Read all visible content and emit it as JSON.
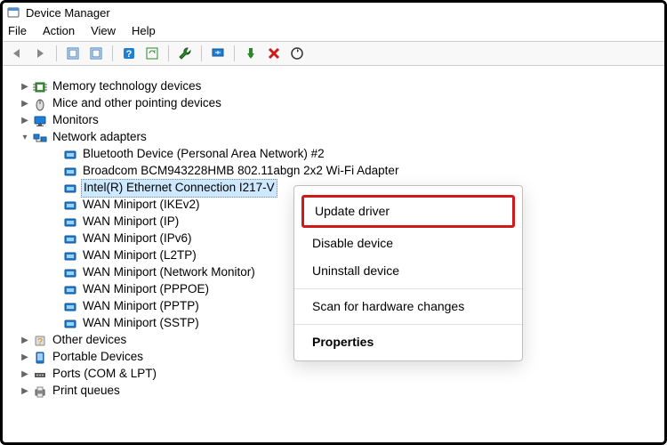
{
  "titlebar": {
    "title": "Device Manager"
  },
  "menubar": {
    "file": "File",
    "action": "Action",
    "view": "View",
    "help": "Help"
  },
  "toolbar_icons": {
    "back": "back-arrow-icon",
    "forward": "forward-arrow-icon",
    "show_hidden": "show-hidden-icon",
    "properties": "properties-icon",
    "help": "help-icon",
    "scan": "scan-hardware-icon",
    "add": "add-legacy-icon",
    "monitor": "remote-icon",
    "enable": "enable-device-icon",
    "remove": "remove-device-icon",
    "refresh": "refresh-icon"
  },
  "tree": {
    "memory": "Memory technology devices",
    "mice": "Mice and other pointing devices",
    "monitors": "Monitors",
    "netcat": "Network adapters",
    "net": {
      "bt": "Bluetooth Device (Personal Area Network) #2",
      "broadcom": "Broadcom BCM943228HMB 802.11abgn 2x2 Wi-Fi Adapter",
      "intel": "Intel(R) Ethernet Connection I217-V",
      "ikev2": "WAN Miniport (IKEv2)",
      "ip": "WAN Miniport (IP)",
      "ipv6": "WAN Miniport (IPv6)",
      "l2tp": "WAN Miniport (L2TP)",
      "netmon": "WAN Miniport (Network Monitor)",
      "pppoe": "WAN Miniport (PPPOE)",
      "pptp": "WAN Miniport (PPTP)",
      "sstp": "WAN Miniport (SSTP)"
    },
    "other": "Other devices",
    "portable": "Portable Devices",
    "ports": "Ports (COM & LPT)",
    "print": "Print queues"
  },
  "context_menu": {
    "update": "Update driver",
    "disable": "Disable device",
    "uninstall": "Uninstall device",
    "scan": "Scan for hardware changes",
    "props": "Properties"
  }
}
